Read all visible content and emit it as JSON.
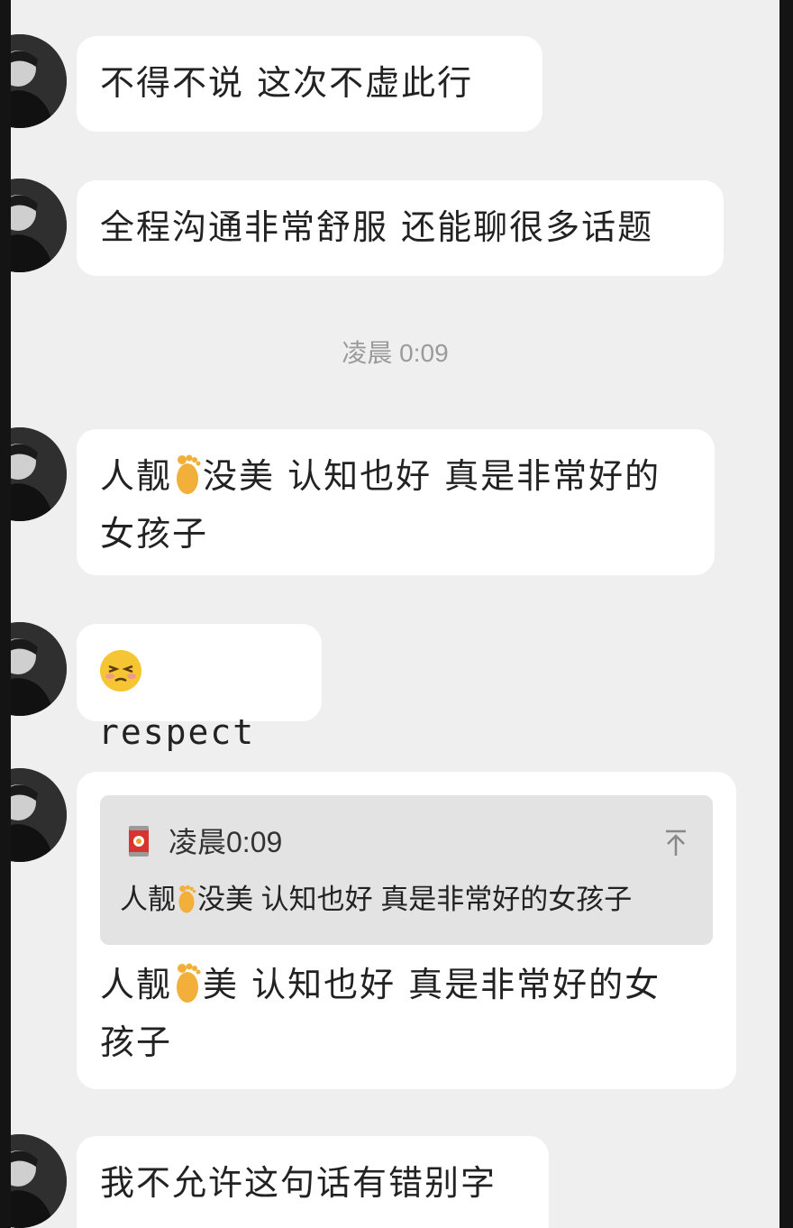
{
  "messages": [
    {
      "text": "不得不说 这次不虚此行"
    },
    {
      "text": "全程沟通非常舒服 还能聊很多话题"
    },
    {
      "text_a": "人靓",
      "text_b": "没美 认知也好 真是非常好的女孩子"
    },
    {
      "text": "respect"
    },
    {
      "quote": {
        "time": "凌晨0:09",
        "text_a": "人靓",
        "text_b": "没美 认知也好 真是非常好的女孩子"
      },
      "text_a": "人靓",
      "text_b": "美 认知也好 真是非常好的女孩子"
    },
    {
      "text": "我不允许这句话有错别字"
    }
  ],
  "timestamp": "凌晨 0:09",
  "icons": {
    "foot": "foot-emoji",
    "face": "embarrassed-face-emoji",
    "quote": "soda-can-icon",
    "scroll_top": "scroll-to-top-icon"
  },
  "colors": {
    "chat_background": "#efefef",
    "bubble": "#ffffff",
    "quote_background": "#e3e3e3",
    "timestamp": "#9a9a9a"
  }
}
